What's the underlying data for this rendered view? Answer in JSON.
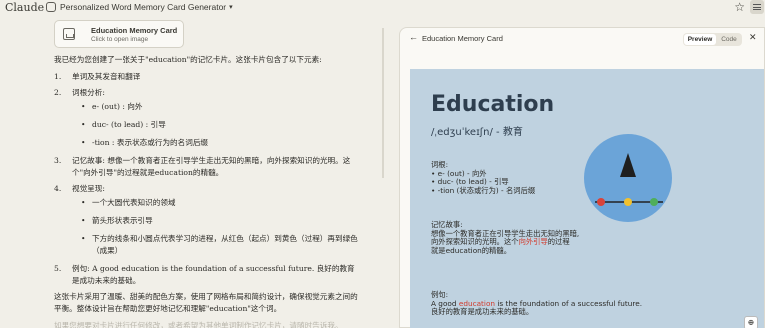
{
  "app": {
    "brand": "Claude"
  },
  "chat_title": "Personalized Word Memory Card Generator",
  "attachment": {
    "title": "Education Memory Card",
    "subtitle": "Click to open image"
  },
  "message": {
    "intro": "我已经为您创建了一张关于\"education\"的记忆卡片。这张卡片包含了以下元素:",
    "items": [
      {
        "num": "1.",
        "text": "单词及其发音和翻译"
      },
      {
        "num": "2.",
        "text": "词根分析:",
        "sub": [
          "e- (out) : 向外",
          "duc- (to lead) : 引导",
          "-tion : 表示状态或行为的名词后缀"
        ]
      },
      {
        "num": "3.",
        "text": "记忆故事: 想像一个教育者正在引导学生走出无知的黑暗，向外探索知识的光明。这个\"向外引导\"的过程就是education的精髓。"
      },
      {
        "num": "4.",
        "text": "视觉呈现:",
        "sub": [
          "一个大圆代表知识的领域",
          "箭头形状表示引导",
          "下方的线条和小圆点代表学习的进程，从红色（起点）到黄色（过程）再到绿色（成果）"
        ]
      },
      {
        "num": "5.",
        "text": "例句: A good education is the foundation of a successful future. 良好的教育是成功未来的基础。"
      }
    ],
    "outro": "这张卡片采用了温暖、甜美的配色方案，使用了网格布局和简约设计，确保视觉元素之间的平衡。整体设计旨在帮助您更好地记忆和理解\"education\"这个词。",
    "faded": "如果您想要对卡片进行任何修改，或者希望为其他单词制作记忆卡片，请随时告诉我。"
  },
  "panel": {
    "title": "Education Memory Card",
    "tabs": {
      "preview": "Preview",
      "code": "Code"
    }
  },
  "card": {
    "word": "Education",
    "phonetic": "/ˌedʒuˈkeɪʃn/ - 教育",
    "roots_label": "词根:",
    "roots": [
      "• e- (out) - 向外",
      "• duc- (to lead) - 引导",
      "• -tion (状态或行为) - 名词后缀"
    ],
    "story_label": "记忆故事:",
    "story_line1": "想像一个教育者正在引导学生走出无知的黑暗,",
    "story_line2_pre": "向外探索知识的光明。这个",
    "story_line2_red": "向外引导",
    "story_line2_post": "的过程",
    "story_line3": "就是education的精髓。",
    "example_label": "例句:",
    "example_pre": "A good ",
    "example_red": "education",
    "example_post": " is the foundation of a successful future.",
    "example_cn": "良好的教育是成功未来的基础。",
    "colors": {
      "circle": "#6ba4d8",
      "start": "#d9433a",
      "middle": "#f2c12e",
      "end": "#4fae5a",
      "accent": "#d13b2d"
    }
  }
}
